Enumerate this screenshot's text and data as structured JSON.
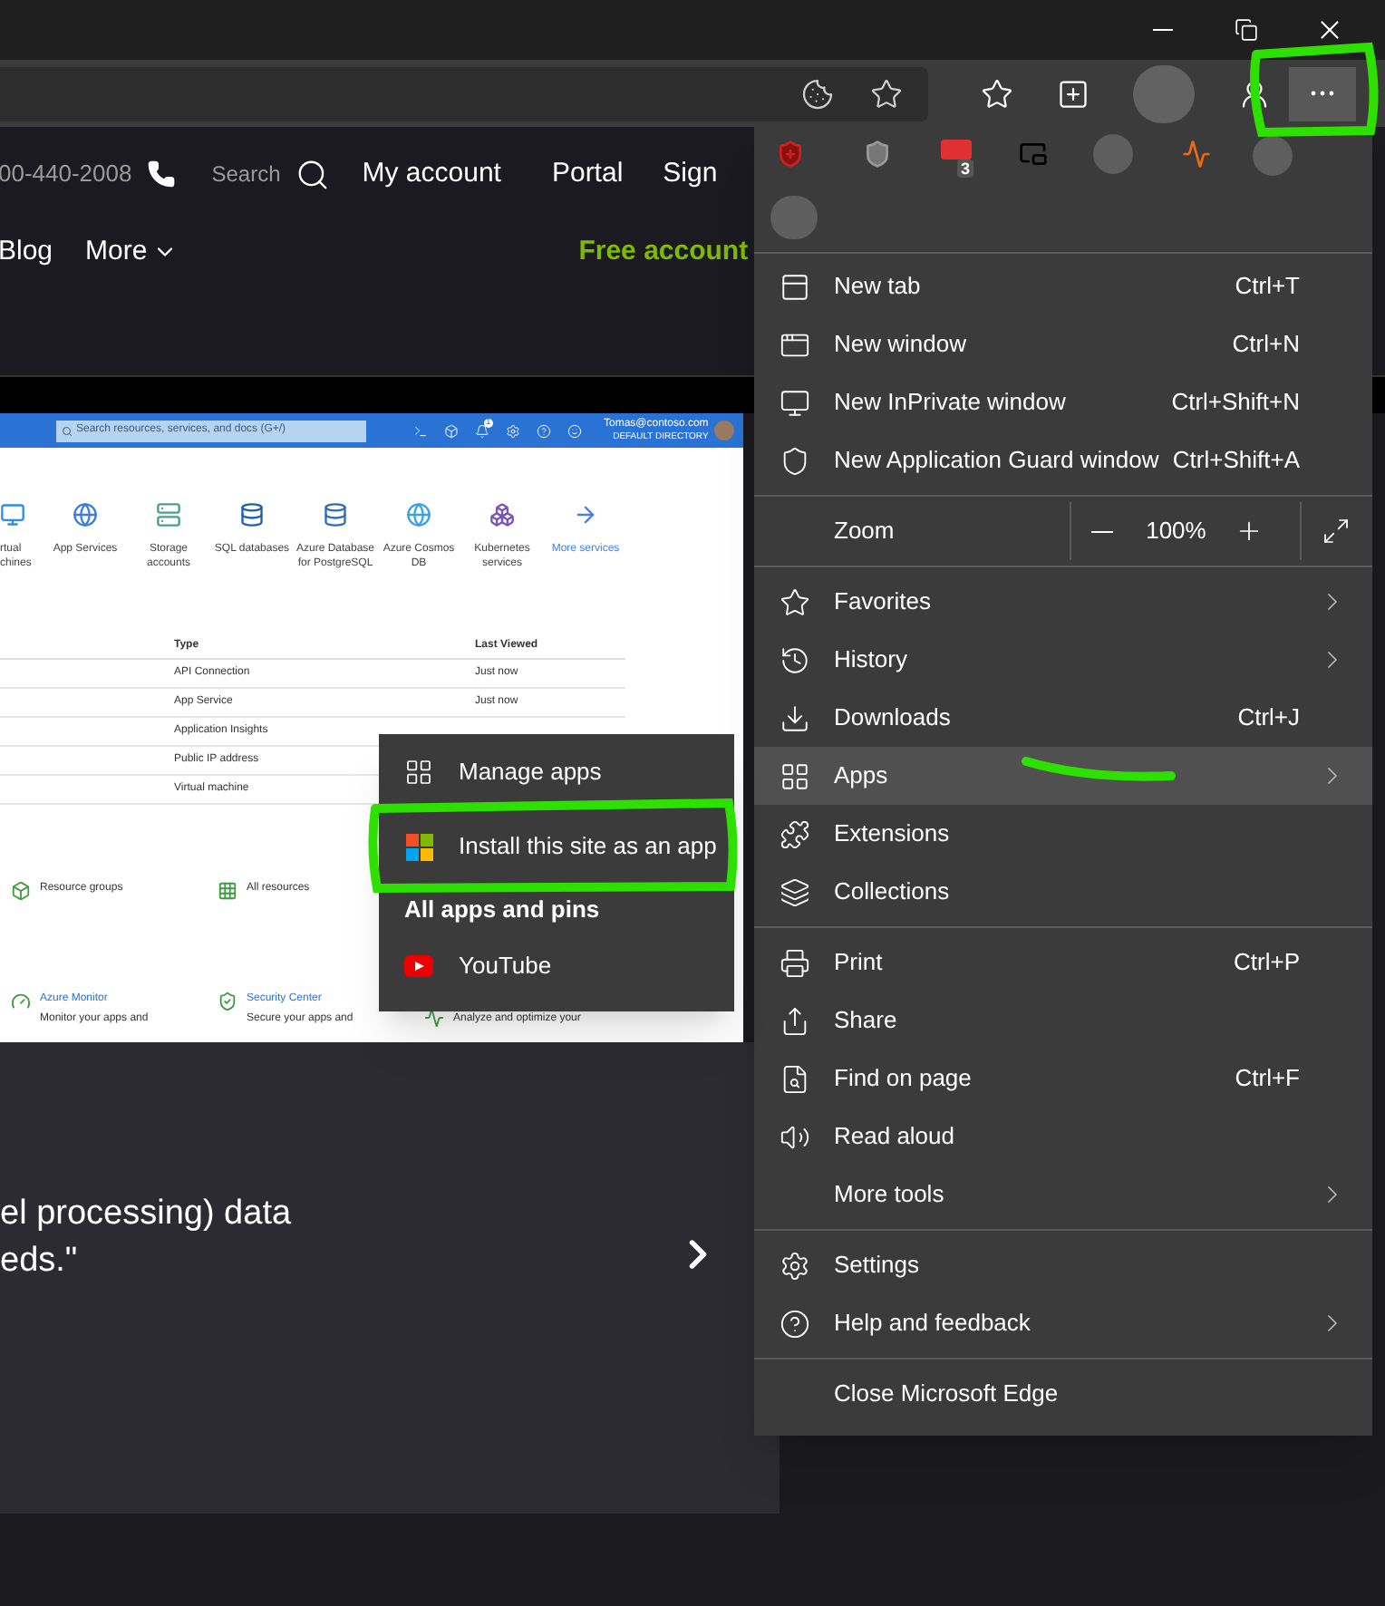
{
  "website": {
    "phone": "00-440-2008",
    "nav": [
      "Search",
      "My account",
      "Portal",
      "Sign"
    ],
    "subnav": [
      "Blog",
      "More"
    ],
    "cta": "Free account",
    "quote_lines": [
      "el processing) data",
      "eds.\""
    ]
  },
  "portal": {
    "search_placeholder": "Search resources, services, and docs (G+/)",
    "notification_count": "1",
    "user": "Tomas@contoso.com",
    "directory": "DEFAULT DIRECTORY",
    "services": [
      {
        "lines": [
          "rtual",
          "chines"
        ],
        "color": "#2f8fe0"
      },
      {
        "lines": [
          "App Services"
        ],
        "color": "#3f7fdc"
      },
      {
        "lines": [
          "Storage",
          "accounts"
        ],
        "color": "#4a9e8a"
      },
      {
        "lines": [
          "SQL databases"
        ],
        "color": "#1d5fb0"
      },
      {
        "lines": [
          "Azure Database",
          "for PostgreSQL"
        ],
        "color": "#2f6cb8"
      },
      {
        "lines": [
          "Azure Cosmos",
          "DB"
        ],
        "color": "#3aa0e8"
      },
      {
        "lines": [
          "Kubernetes",
          "services"
        ],
        "color": "#7a55b8"
      },
      {
        "lines": [
          "More services"
        ],
        "color": "#4a7fe0"
      }
    ],
    "table": {
      "columns": [
        "Type",
        "Last Viewed"
      ],
      "rows": [
        [
          "API Connection",
          "Just now"
        ],
        [
          "App Service",
          "Just now"
        ],
        [
          "Application Insights"
        ],
        [
          "Public IP address"
        ],
        [
          "Virtual machine"
        ]
      ]
    },
    "tile_rows": [
      [
        {
          "title": "Resource groups",
          "kind": "plain"
        },
        {
          "title": "All resources",
          "kind": "plain"
        }
      ],
      [
        {
          "title": "Azure Monitor",
          "desc": "Monitor your apps and",
          "kind": "link"
        },
        {
          "title": "Security Center",
          "desc": "Secure your apps and",
          "kind": "link"
        },
        {
          "desc": "Analyze and optimize your",
          "kind": "description"
        }
      ]
    ]
  },
  "menu": {
    "extension_badge": "3",
    "items": [
      {
        "kind": "item",
        "label": "New tab",
        "shortcut": "Ctrl+T",
        "submenu": false,
        "highlighted": false
      },
      {
        "kind": "item",
        "label": "New window",
        "shortcut": "Ctrl+N",
        "submenu": false,
        "highlighted": false
      },
      {
        "kind": "item",
        "label": "New InPrivate window",
        "shortcut": "Ctrl+Shift+N",
        "submenu": false,
        "highlighted": false
      },
      {
        "kind": "item",
        "label": "New Application Guard window",
        "shortcut": "Ctrl+Shift+A",
        "submenu": false,
        "highlighted": false
      },
      {
        "kind": "divider"
      },
      {
        "kind": "zoom",
        "label": "Zoom",
        "value": "100%"
      },
      {
        "kind": "divider"
      },
      {
        "kind": "item",
        "label": "Favorites",
        "submenu": true,
        "highlighted": false
      },
      {
        "kind": "item",
        "label": "History",
        "submenu": true,
        "highlighted": false
      },
      {
        "kind": "item",
        "label": "Downloads",
        "shortcut": "Ctrl+J",
        "submenu": false,
        "highlighted": false
      },
      {
        "kind": "item",
        "label": "Apps",
        "submenu": true,
        "highlighted": true
      },
      {
        "kind": "item",
        "label": "Extensions",
        "submenu": false,
        "highlighted": false
      },
      {
        "kind": "item",
        "label": "Collections",
        "submenu": false,
        "highlighted": false
      },
      {
        "kind": "divider"
      },
      {
        "kind": "item",
        "label": "Print",
        "shortcut": "Ctrl+P",
        "submenu": false,
        "highlighted": false
      },
      {
        "kind": "item",
        "label": "Share",
        "submenu": false,
        "highlighted": false
      },
      {
        "kind": "item",
        "label": "Find on page",
        "shortcut": "Ctrl+F",
        "submenu": false,
        "highlighted": false
      },
      {
        "kind": "item",
        "label": "Read aloud",
        "submenu": false,
        "highlighted": false
      },
      {
        "kind": "item",
        "label": "More tools",
        "submenu": true,
        "highlighted": false
      },
      {
        "kind": "divider"
      },
      {
        "kind": "item",
        "label": "Settings",
        "submenu": false,
        "highlighted": false
      },
      {
        "kind": "item",
        "label": "Help and feedback",
        "submenu": true,
        "highlighted": false
      },
      {
        "kind": "divider"
      },
      {
        "kind": "item",
        "label": "Close Microsoft Edge",
        "submenu": false,
        "highlighted": false
      }
    ]
  },
  "apps_submenu": {
    "items": [
      {
        "kind": "item",
        "label": "Manage apps"
      },
      {
        "kind": "item",
        "label": "Install this site as an app"
      },
      {
        "kind": "heading",
        "label": "All apps and pins"
      },
      {
        "kind": "item",
        "label": "YouTube"
      }
    ]
  }
}
